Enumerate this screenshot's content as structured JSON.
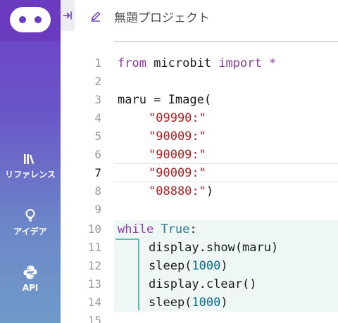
{
  "app": {
    "project_title": "無題プロジェクト"
  },
  "sidebar": {
    "logo_icon": "microbit-logo-icon",
    "items": [
      {
        "label": "リファレンス",
        "icon": "books-icon"
      },
      {
        "label": "アイデア",
        "icon": "lightbulb-icon"
      },
      {
        "label": "API",
        "icon": "python-icon"
      }
    ]
  },
  "editor": {
    "active_line": 7,
    "lines": [
      {
        "num": "1"
      },
      {
        "num": "2"
      },
      {
        "num": "3"
      },
      {
        "num": "4"
      },
      {
        "num": "5"
      },
      {
        "num": "6"
      },
      {
        "num": "7"
      },
      {
        "num": "8"
      },
      {
        "num": "9"
      },
      {
        "num": "10"
      },
      {
        "num": "11"
      },
      {
        "num": "12"
      },
      {
        "num": "13"
      },
      {
        "num": "14"
      },
      {
        "num": "15"
      }
    ],
    "tokens": {
      "l1_from": "from",
      "l1_mod": " microbit ",
      "l1_import": "import",
      "l1_star": " *",
      "l3_a": "maru = Image(",
      "l4": "\"09990:\"",
      "l5": "\"90009:\"",
      "l6": "\"90009:\"",
      "l7": "\"90009:\"",
      "l8_str": "\"08880:\"",
      "l8_close": ")",
      "l10_while": "while",
      "l10_true": "True",
      "l10_colon": ":",
      "l11": "display.show(maru)",
      "l12_a": "sleep(",
      "l12_num": "1000",
      "l12_b": ")",
      "l13": "display.clear()",
      "l14_a": "sleep(",
      "l14_num": "1000",
      "l14_b": ")"
    }
  },
  "colors": {
    "sidebar_top": "#6d3fc8",
    "sidebar_bottom": "#6f9bc9",
    "keyword": "#8d3aa6",
    "string": "#b01e1e",
    "number": "#0b6e8a"
  }
}
